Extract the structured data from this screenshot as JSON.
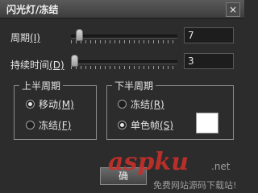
{
  "window": {
    "title": "闪光灯/冻结",
    "close_label": "×"
  },
  "period": {
    "label_text": "周期",
    "label_hotkey": "(I)",
    "value": "7",
    "slider_fraction": 0.05
  },
  "duration": {
    "label_text": "持续时间",
    "label_hotkey": "(D)",
    "value": "3",
    "slider_fraction": 0.0
  },
  "upper": {
    "title": "上半周期",
    "options": [
      {
        "label": "移动",
        "hotkey": "(M)",
        "checked": true
      },
      {
        "label": "冻结",
        "hotkey": "(F)",
        "checked": false
      }
    ]
  },
  "lower": {
    "title": "下半周期",
    "options": [
      {
        "label": "冻结",
        "hotkey": "(R)",
        "checked": false
      },
      {
        "label": "单色帧",
        "hotkey": "(S)",
        "checked": true
      }
    ],
    "swatch_color": "#ffffff"
  },
  "footer": {
    "button_label": "确"
  },
  "watermark": {
    "brand": "aspku",
    "suffix": ".net",
    "subtitle": "免费网站源码下载站!"
  }
}
